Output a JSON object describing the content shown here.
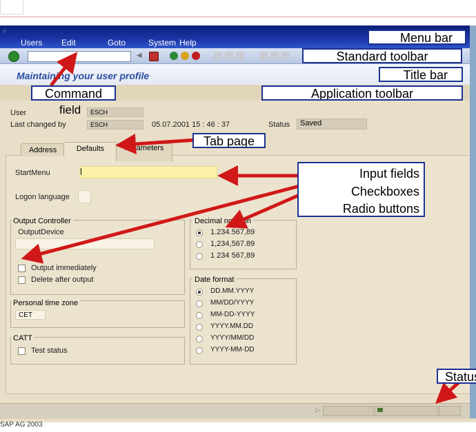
{
  "menu": {
    "items": [
      "Users",
      "Edit",
      "Goto",
      "System",
      "Help"
    ]
  },
  "title": "Maintaining your user profile",
  "header": {
    "user_label": "User",
    "user_value": "ESCH",
    "last_changed_label": "Last changed by",
    "last_changed_value": "ESCH",
    "date_time": "05.07.2001  15 : 46 : 37",
    "status_label": "Status",
    "status_value": "Saved"
  },
  "tabs": [
    "Address",
    "Defaults",
    "Parameters"
  ],
  "form": {
    "startmenu_label": "StartMenu",
    "logon_language_label": "Logon language",
    "output_controller_title": "Output Controller",
    "output_device_label": "OutputDevice",
    "output_immediately_label": "Output immediately",
    "delete_after_output_label": "Delete after output",
    "personal_tz_title": "Personal time zone",
    "personal_tz_value": "CET",
    "catt_title": "CATT",
    "test_status_label": "Test status",
    "decimal_title": "Decimal notation",
    "decimal_options": [
      "1.234.567,89",
      "1,234,567.89",
      "1 234 567,89"
    ],
    "decimal_selected": 0,
    "date_title": "Date format",
    "date_options": [
      "DD.MM.YYYY",
      "MM/DD/YYYY",
      "MM-DD-YYYY",
      "YYYY.MM.DD",
      "YYYY/MM/DD",
      "YYYY-MM-DD"
    ],
    "date_selected": 0
  },
  "annotations": {
    "menu_bar": "Menu bar",
    "standard_toolbar": "Standard toolbar",
    "title_bar": "Title bar",
    "command": "Command",
    "field": "field",
    "application_toolbar": "Application toolbar",
    "tab_page": "Tab page",
    "input_fields": "Input fields",
    "checkboxes": "Checkboxes",
    "radio_buttons": "Radio buttons",
    "status": "Status"
  },
  "footer_text": "SAP AG 2003",
  "colors": {
    "annotation_border": "#1a3190",
    "arrow": "#d01818",
    "title_text": "#2a4da0"
  }
}
